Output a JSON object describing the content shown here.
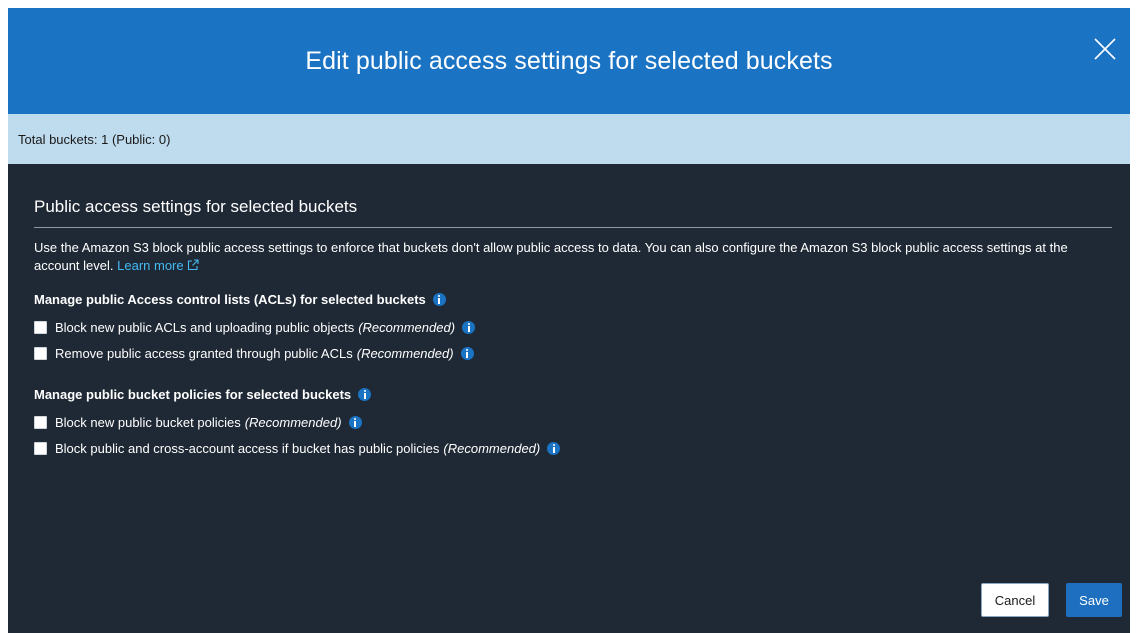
{
  "modal": {
    "title": "Edit public access settings for selected buckets",
    "summary": "Total buckets: 1 (Public: 0)"
  },
  "section": {
    "title": "Public access settings for selected buckets",
    "description": "Use the Amazon S3 block public access settings to enforce that buckets don't allow public access to data. You can also configure the Amazon S3 block public access settings at the account level.",
    "learn_more_label": "Learn more"
  },
  "groups": [
    {
      "heading": "Manage public Access control lists (ACLs) for selected buckets",
      "options": [
        {
          "label": "Block new public ACLs and uploading public objects",
          "note": "(Recommended)",
          "checked": false
        },
        {
          "label": "Remove public access granted through public ACLs",
          "note": "(Recommended)",
          "checked": false
        }
      ]
    },
    {
      "heading": "Manage public bucket policies for selected buckets",
      "options": [
        {
          "label": "Block new public bucket policies",
          "note": "(Recommended)",
          "checked": false
        },
        {
          "label": "Block public and cross-account access if bucket has public policies",
          "note": "(Recommended)",
          "checked": false
        }
      ]
    }
  ],
  "buttons": {
    "cancel_label": "Cancel",
    "save_label": "Save"
  },
  "icons": {
    "close": "close-icon",
    "external_link": "external-link-icon",
    "info": "info-icon"
  },
  "colors": {
    "header_bg": "#1b73c4",
    "summary_bg": "#bfdbee",
    "body_bg": "#1f2935",
    "link": "#44b9f3",
    "primary_button": "#1e6fc0"
  }
}
